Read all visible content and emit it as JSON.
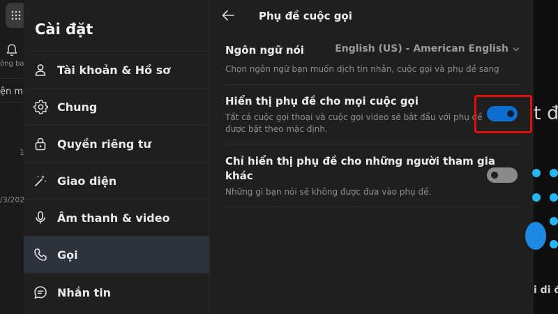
{
  "background_app": {
    "notification_label_partial": "ông ba",
    "new_chat_partial": "ện mớ",
    "number_partial": "1",
    "date_partial": "/3/202",
    "right_heading_partial": "t đầ",
    "right_subheading_partial": "i di đ",
    "accent_color": "#27b7f0"
  },
  "sidebar": {
    "title": "Cài đặt",
    "items": [
      {
        "label": "Tài khoản & Hồ sơ",
        "icon": "person-icon",
        "active": false
      },
      {
        "label": "Chung",
        "icon": "gear-icon",
        "active": false
      },
      {
        "label": "Quyền riêng tư",
        "icon": "lock-icon",
        "active": false
      },
      {
        "label": "Giao diện",
        "icon": "magic-wand-icon",
        "active": false
      },
      {
        "label": "Âm thanh & video",
        "icon": "microphone-icon",
        "active": false
      },
      {
        "label": "Gọi",
        "icon": "phone-icon",
        "active": true
      },
      {
        "label": "Nhắn tin",
        "icon": "chat-bubble-icon",
        "active": false
      }
    ]
  },
  "panel": {
    "title": "Phụ đề cuộc gọi",
    "language": {
      "title": "Ngôn ngữ nói",
      "selected": "English (US) - American English",
      "description": "Chọn ngôn ngữ bạn muốn dịch tin nhắn, cuộc gọi và phụ đề sang"
    },
    "subtitles_all_calls": {
      "title": "Hiển thị phụ đề cho mọi cuộc gọi",
      "description_line1": "Tất cả cuộc gọi thoại và cuộc gọi video sẽ bắt đầu với phụ đề",
      "description_line2": "được bật theo mặc định.",
      "enabled": true
    },
    "subtitles_others_only": {
      "title_line1": "Chỉ hiển thị phụ đề cho những người tham gia",
      "title_line2": "khác",
      "description": "Những gì bạn nói sẽ không được đưa vào phụ đề.",
      "enabled": false
    }
  },
  "colors": {
    "toggle_on": "#0f6fd0",
    "highlight_box": "#e01010"
  }
}
